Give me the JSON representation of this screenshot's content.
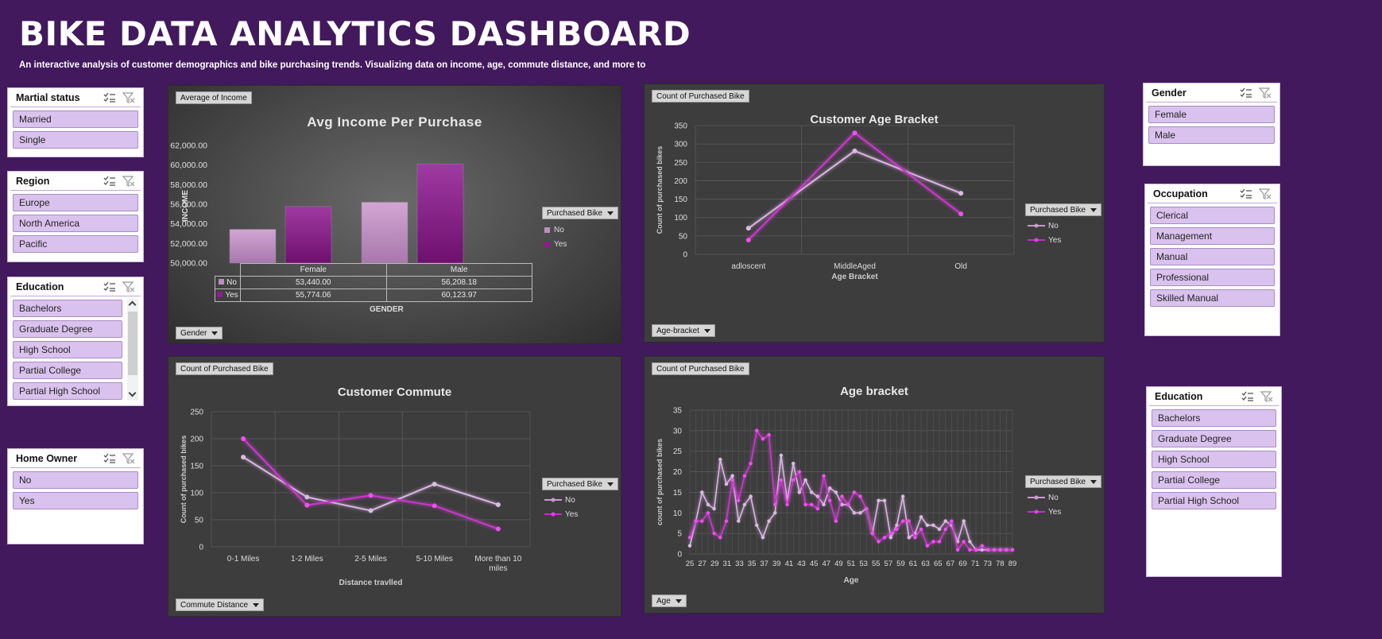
{
  "header": {
    "title": "BIKE DATA ANALYTICS DASHBOARD",
    "subtitle": "An interactive analysis of customer demographics and bike purchasing trends. Visualizing data on income, age, commute distance, and more to"
  },
  "colors": {
    "background": "#41195c",
    "series_no": "#c89ad0",
    "series_yes": "#c030c8",
    "bar_no": "#bd8cc0",
    "bar_yes": "#8e1d8e",
    "slicer_item": "#dac2ee"
  },
  "slicers": {
    "marital": {
      "title": "Martial status",
      "items": [
        "Married",
        "Single"
      ]
    },
    "region": {
      "title": "Region",
      "items": [
        "Europe",
        "North America",
        "Pacific"
      ]
    },
    "education_left": {
      "title": "Education",
      "items": [
        "Bachelors",
        "Graduate Degree",
        "High School",
        "Partial College",
        "Partial High School"
      ]
    },
    "home_owner": {
      "title": "Home Owner",
      "items": [
        "No",
        "Yes"
      ]
    },
    "gender": {
      "title": "Gender",
      "items": [
        "Female",
        "Male"
      ]
    },
    "occupation": {
      "title": "Occupation",
      "items": [
        "Clerical",
        "Management",
        "Manual",
        "Professional",
        "Skilled Manual"
      ]
    },
    "education_right": {
      "title": "Education",
      "items": [
        "Bachelors",
        "Graduate Degree",
        "High School",
        "Partial College",
        "Partial High School"
      ]
    }
  },
  "charts": {
    "income": {
      "value_tag": "Average of Income",
      "filter_button": "Gender",
      "legend_title": "Purchased Bike",
      "legend_items": [
        "No",
        "Yes"
      ]
    },
    "age_bracket": {
      "value_tag": "Count of Purchased Bike",
      "filter_button": "Age-bracket",
      "legend_title": "Purchased Bike",
      "legend_items": [
        "No",
        "Yes"
      ]
    },
    "commute": {
      "value_tag": "Count of Purchased Bike",
      "filter_button": "Commute Distance",
      "legend_title": "Purchased Bike",
      "legend_items": [
        "No",
        "Yes"
      ]
    },
    "age": {
      "value_tag": "Count of Purchased Bike",
      "filter_button": "Age",
      "legend_title": "Purchased Bike",
      "legend_items": [
        "No",
        "Yes"
      ]
    }
  },
  "chart_data": [
    {
      "type": "bar",
      "title": "Avg Income Per Purchase",
      "xlabel": "GENDER",
      "ylabel": "INCOME",
      "categories": [
        "Female",
        "Male"
      ],
      "series": [
        {
          "name": "No",
          "values": [
            53440.0,
            56208.18
          ],
          "labels": [
            "53,440.00",
            "56,208.18"
          ]
        },
        {
          "name": "Yes",
          "values": [
            55774.06,
            60123.97
          ],
          "labels": [
            "55,774.06",
            "60,123.97"
          ]
        }
      ],
      "ylim": [
        50000,
        62000
      ],
      "yticks": [
        "62,000.00",
        "60,000.00",
        "58,000.00",
        "56,000.00",
        "54,000.00",
        "52,000.00",
        "50,000.00"
      ],
      "legend": "right",
      "data_table": true
    },
    {
      "type": "line",
      "title": "Customer Age Bracket",
      "xlabel": "Age Bracket",
      "ylabel": "Count of purchased bikes",
      "categories": [
        "adloscent",
        "MiddleAged",
        "Old"
      ],
      "series": [
        {
          "name": "No",
          "values": [
            71,
            281,
            166
          ]
        },
        {
          "name": "Yes",
          "values": [
            39,
            330,
            110
          ]
        }
      ],
      "ylim": [
        0,
        350
      ],
      "yticks": [
        "350",
        "300",
        "250",
        "200",
        "150",
        "100",
        "50",
        "0"
      ],
      "legend": "right",
      "grid": true
    },
    {
      "type": "line",
      "title": "Customer Commute",
      "xlabel": "Distance travlled",
      "ylabel": "Count of purchased bikes",
      "categories": [
        "0-1 Miles",
        "1-2 Miles",
        "2-5 Miles",
        "5-10 Miles",
        "More than 10 miles"
      ],
      "series": [
        {
          "name": "No",
          "values": [
            166,
            92,
            67,
            116,
            78
          ]
        },
        {
          "name": "Yes",
          "values": [
            200,
            77,
            95,
            76,
            33
          ]
        }
      ],
      "ylim": [
        0,
        250
      ],
      "yticks": [
        "250",
        "200",
        "150",
        "100",
        "50",
        "0"
      ],
      "legend": "right",
      "grid": true
    },
    {
      "type": "line",
      "title": "Age bracket",
      "xlabel": "Age",
      "ylabel": "count of purchased bikes",
      "x": [
        25,
        26,
        27,
        28,
        29,
        30,
        31,
        32,
        33,
        34,
        35,
        36,
        37,
        38,
        39,
        40,
        41,
        42,
        43,
        44,
        45,
        46,
        47,
        48,
        49,
        50,
        51,
        52,
        53,
        54,
        55,
        56,
        57,
        58,
        59,
        60,
        61,
        62,
        63,
        64,
        65,
        66,
        67,
        68,
        69,
        70,
        71,
        72,
        73,
        74,
        75,
        76,
        77,
        78
      ],
      "x_tick_labels": [
        "25",
        "27",
        "29",
        "31",
        "33",
        "35",
        "37",
        "39",
        "41",
        "43",
        "45",
        "47",
        "49",
        "51",
        "53",
        "55",
        "57",
        "59",
        "61",
        "63",
        "65",
        "67",
        "69",
        "71",
        "73",
        "78",
        "89"
      ],
      "series": [
        {
          "name": "No",
          "values": [
            2,
            8,
            15,
            12,
            11,
            23,
            17,
            19,
            8,
            12,
            14,
            7,
            4,
            8,
            10,
            24,
            13,
            22,
            15,
            18,
            15,
            14,
            12,
            16,
            15,
            12,
            12,
            10,
            10,
            11,
            5,
            13,
            13,
            4,
            7,
            14,
            4,
            5,
            9,
            7,
            7,
            6,
            8,
            7,
            3,
            8,
            3,
            1,
            1,
            1,
            1,
            1,
            1,
            1
          ]
        },
        {
          "name": "Yes",
          "values": [
            4,
            8,
            8,
            10,
            5,
            4,
            8,
            18,
            13,
            19,
            22,
            30,
            28,
            29,
            12,
            18,
            12,
            18,
            20,
            12,
            12,
            11,
            19,
            13,
            8,
            14,
            12,
            15,
            14,
            11,
            5,
            3,
            4,
            5,
            6,
            8,
            8,
            4,
            6,
            2,
            3,
            3,
            6,
            8,
            1,
            3,
            1,
            1,
            2,
            1,
            1,
            1,
            1,
            1
          ]
        }
      ],
      "ylim": [
        0,
        35
      ],
      "yticks": [
        "35",
        "30",
        "25",
        "20",
        "15",
        "10",
        "5",
        "0"
      ],
      "legend": "right",
      "grid": true
    }
  ]
}
